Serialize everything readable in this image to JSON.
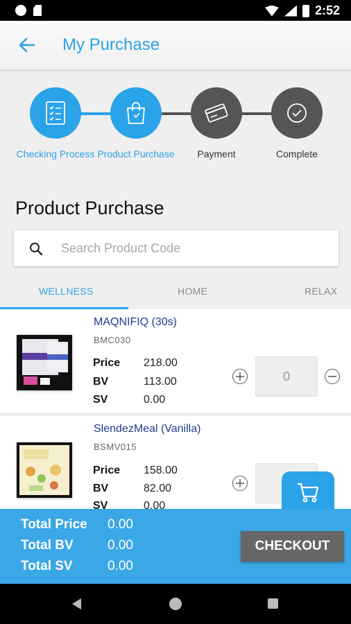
{
  "status_bar": {
    "time": "2:52"
  },
  "header": {
    "title": "My Purchase",
    "back_icon": "arrow-left-icon"
  },
  "steps": [
    {
      "label": "Checking Process",
      "state": "active",
      "icon": "checklist-icon"
    },
    {
      "label": "Product Purchase",
      "state": "active",
      "icon": "shopping-bag-icon"
    },
    {
      "label": "Payment",
      "state": "inactive",
      "icon": "credit-card-icon"
    },
    {
      "label": "Complete",
      "state": "inactive",
      "icon": "check-circle-icon"
    }
  ],
  "section_title": "Product Purchase",
  "search": {
    "placeholder": "Search Product Code",
    "value": ""
  },
  "tabs": [
    {
      "label": "WELLNESS",
      "active": true
    },
    {
      "label": "HOME",
      "active": false
    },
    {
      "label": "RELAX",
      "active": false
    }
  ],
  "fields": {
    "price": "Price",
    "bv": "BV",
    "sv": "SV"
  },
  "products": [
    {
      "name": "MAQNIFIQ (30s)",
      "code": "BMC030",
      "price": "218.00",
      "bv": "113.00",
      "sv": "0.00",
      "qty": "0"
    },
    {
      "name": "SlendezMeal (Vanilla)",
      "code": "BSMV015",
      "price": "158.00",
      "bv": "82.00",
      "sv": "0.00",
      "qty": ""
    }
  ],
  "totals": {
    "price_label": "Total Price",
    "price": "0.00",
    "bv_label": "Total BV",
    "bv": "0.00",
    "sv_label": "Total SV",
    "sv": "0.00"
  },
  "checkout_label": "CHECKOUT",
  "colors": {
    "accent": "#2aa3e8",
    "inactive_step": "#555555",
    "totals_bar": "#3aa7e6",
    "checkout": "#666666"
  }
}
